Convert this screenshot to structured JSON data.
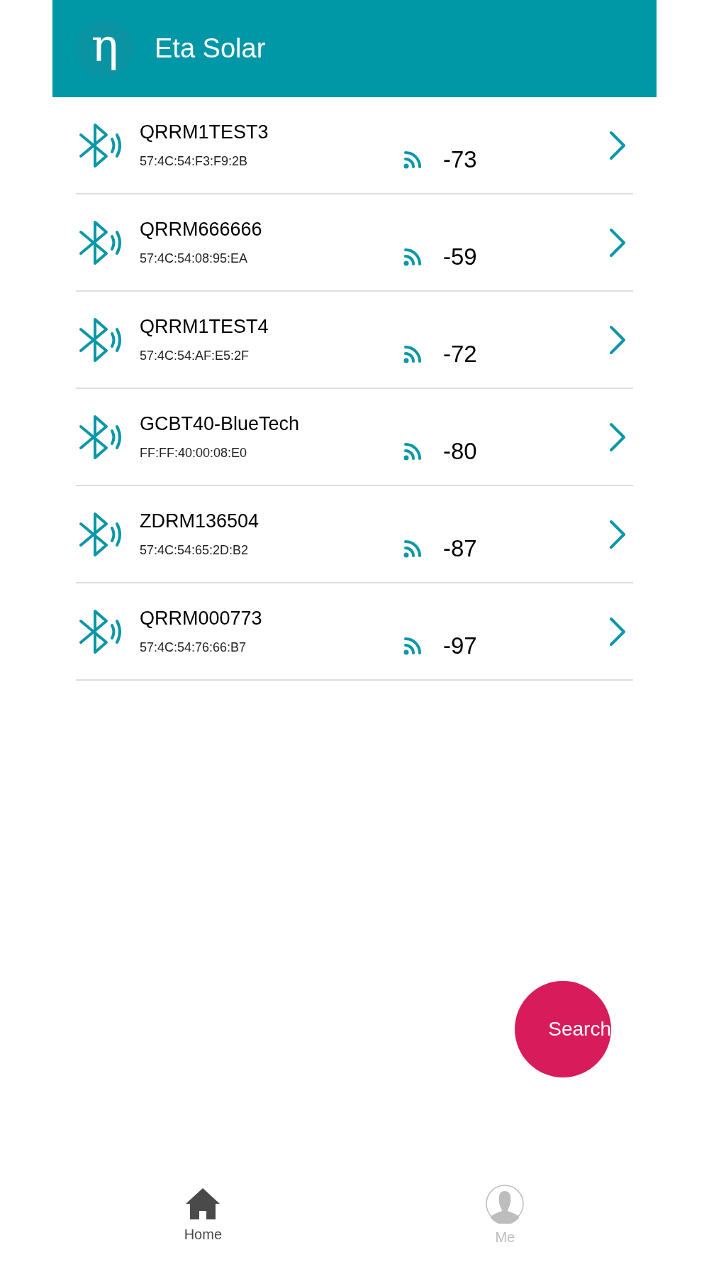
{
  "header": {
    "logo": "η",
    "title": "Eta Solar"
  },
  "devices": [
    {
      "name": "QRRM1TEST3",
      "address": "57:4C:54:F3:F9:2B",
      "rssi": "-73"
    },
    {
      "name": "QRRM666666",
      "address": "57:4C:54:08:95:EA",
      "rssi": "-59"
    },
    {
      "name": "QRRM1TEST4",
      "address": "57:4C:54:AF:E5:2F",
      "rssi": "-72"
    },
    {
      "name": "GCBT40-BlueTech",
      "address": "FF:FF:40:00:08:E0",
      "rssi": "-80"
    },
    {
      "name": "ZDRM136504",
      "address": "57:4C:54:65:2D:B2",
      "rssi": "-87"
    },
    {
      "name": "QRRM000773",
      "address": "57:4C:54:76:66:B7",
      "rssi": "-97"
    }
  ],
  "search_button": "Search",
  "tabs": [
    {
      "label": "Home",
      "kind": "home",
      "selected": true
    },
    {
      "label": "Me",
      "kind": "me",
      "selected": false
    }
  ]
}
